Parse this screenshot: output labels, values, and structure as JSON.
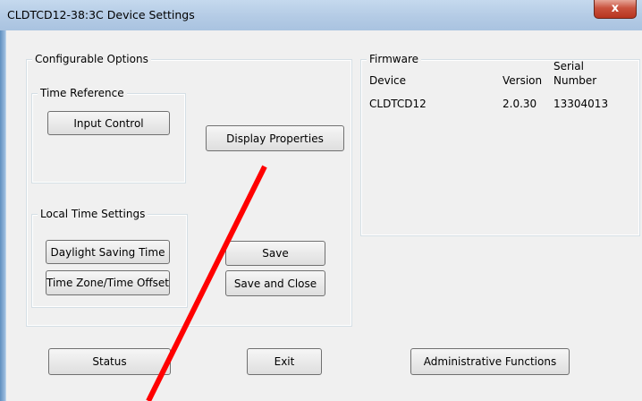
{
  "window": {
    "title": "CLDTCD12-38:3C  Device Settings",
    "close_label": "x"
  },
  "configurable_options": {
    "title": "Configurable Options",
    "time_reference": {
      "title": "Time Reference",
      "input_control_label": "Input Control"
    },
    "display_properties_label": "Display Properties",
    "local_time_settings": {
      "title": "Local Time Settings",
      "daylight_saving_label": "Daylight Saving Time",
      "time_zone_label": "Time Zone/Time Offset"
    },
    "save_label": "Save",
    "save_close_label": "Save and Close"
  },
  "firmware": {
    "title": "Firmware",
    "headers": {
      "device": "Device",
      "version": "Version",
      "serial_line1": "Serial",
      "serial_line2": "Number"
    },
    "rows": [
      {
        "device": "CLDTCD12",
        "version": "2.0.30",
        "serial": "13304013"
      }
    ]
  },
  "bottom": {
    "status_label": "Status",
    "exit_label": "Exit",
    "admin_label": "Administrative Functions"
  },
  "colors": {
    "annotation_arrow": "#ff0000",
    "close_button": "#c9523e"
  }
}
